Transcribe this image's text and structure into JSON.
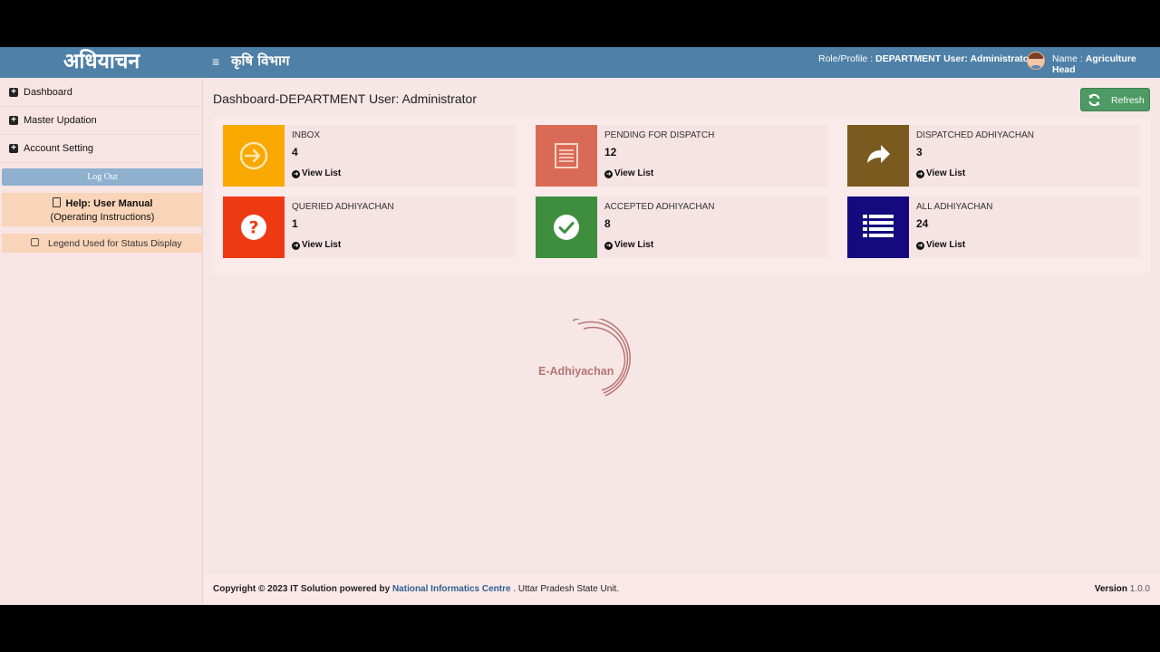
{
  "header": {
    "brand": "अधियाचन",
    "menu_icon": "≡",
    "department": "कृषि विभाग",
    "role_label": "Role/Profile :",
    "role_value": "DEPARTMENT User: Administrator",
    "name_label": "Name :",
    "name_value": "Agriculture Head",
    "color": "#4f80a7"
  },
  "sidebar": {
    "items": [
      {
        "label": "Dashboard",
        "icon": "plus-square-icon"
      },
      {
        "label": "Master Updation",
        "icon": "plus-square-icon"
      },
      {
        "label": "Account Setting",
        "icon": "plus-square-icon"
      }
    ],
    "logout_label": "Log Out",
    "help_title": "Help: User Manual",
    "help_subtitle": "(Operating Instructions)",
    "legend_label": "Legend Used for Status Display"
  },
  "main": {
    "title": "Dashboard-DEPARTMENT User: Administrator",
    "refresh_label": "Refresh",
    "link_label": "View List",
    "cards": [
      {
        "name": "INBOX",
        "value": "4",
        "color": "#f9a800",
        "icon": "sign-in-icon"
      },
      {
        "name": "PENDING FOR DISPATCH",
        "value": "12",
        "color": "#d96a55",
        "icon": "list-alt-icon"
      },
      {
        "name": "DISPATCHED ADHIYACHAN",
        "value": "3",
        "color": "#7a5a1e",
        "icon": "share-arrow-icon"
      },
      {
        "name": "QUERIED ADHIYACHAN",
        "value": "1",
        "color": "#ee3a13",
        "icon": "question-circle-icon"
      },
      {
        "name": "ACCEPTED ADHIYACHAN",
        "value": "8",
        "color": "#3e8e3e",
        "icon": "check-circle-icon"
      },
      {
        "name": "ALL ADHIYACHAN",
        "value": "24",
        "color": "#140a7d",
        "icon": "list-icon"
      }
    ],
    "loader_text": "E-Adhiyachan"
  },
  "footer": {
    "copyright_prefix": "Copyright © 2023 IT Solution powered by",
    "nic": "National Informatics Centre",
    "suffix": ". Uttar Pradesh State Unit.",
    "version_label": "Version",
    "version_value": "1.0.0"
  }
}
